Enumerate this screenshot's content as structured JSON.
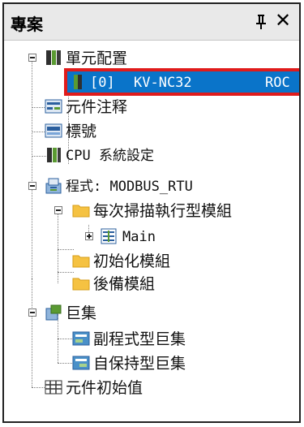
{
  "panel": {
    "title": "專案",
    "pin_icon": "pin-icon",
    "close_icon": "close-icon",
    "close_glyph": "✕"
  },
  "tree": {
    "unit_config": {
      "label": "單元配置",
      "icon": "unit-config-icon"
    },
    "module": {
      "slot": "[0]",
      "name": "KV-NC32",
      "suffix": "ROC",
      "icon": "module-icon"
    },
    "device_comment": {
      "label": "元件注释",
      "icon": "device-comment-icon"
    },
    "label_item": {
      "label": "標號",
      "icon": "label-icon"
    },
    "cpu_settings": {
      "label": "CPU 系統設定",
      "icon": "cpu-settings-icon"
    },
    "program": {
      "label": "程式: MODBUS_RTU",
      "icon": "program-icon"
    },
    "scan_module": {
      "label": "每次掃描執行型模組",
      "icon": "folder-icon"
    },
    "main": {
      "label": "Main",
      "icon": "ladder-icon"
    },
    "init_module": {
      "label": "初始化模組",
      "icon": "folder-icon"
    },
    "standby_module": {
      "label": "後備模組",
      "icon": "folder-icon"
    },
    "macro": {
      "label": "巨集",
      "icon": "macro-icon"
    },
    "subroutine_macro": {
      "label": "副程式型巨集",
      "icon": "subroutine-macro-icon"
    },
    "self_hold_macro": {
      "label": "自保持型巨集",
      "icon": "self-hold-macro-icon"
    },
    "initial_values": {
      "label": "元件初始值",
      "icon": "grid-icon"
    }
  },
  "colors": {
    "selection": "#0a74c9",
    "highlight_border": "#e01b1b",
    "folder": "#f5c242",
    "titlebar": "#e9e9e9"
  }
}
